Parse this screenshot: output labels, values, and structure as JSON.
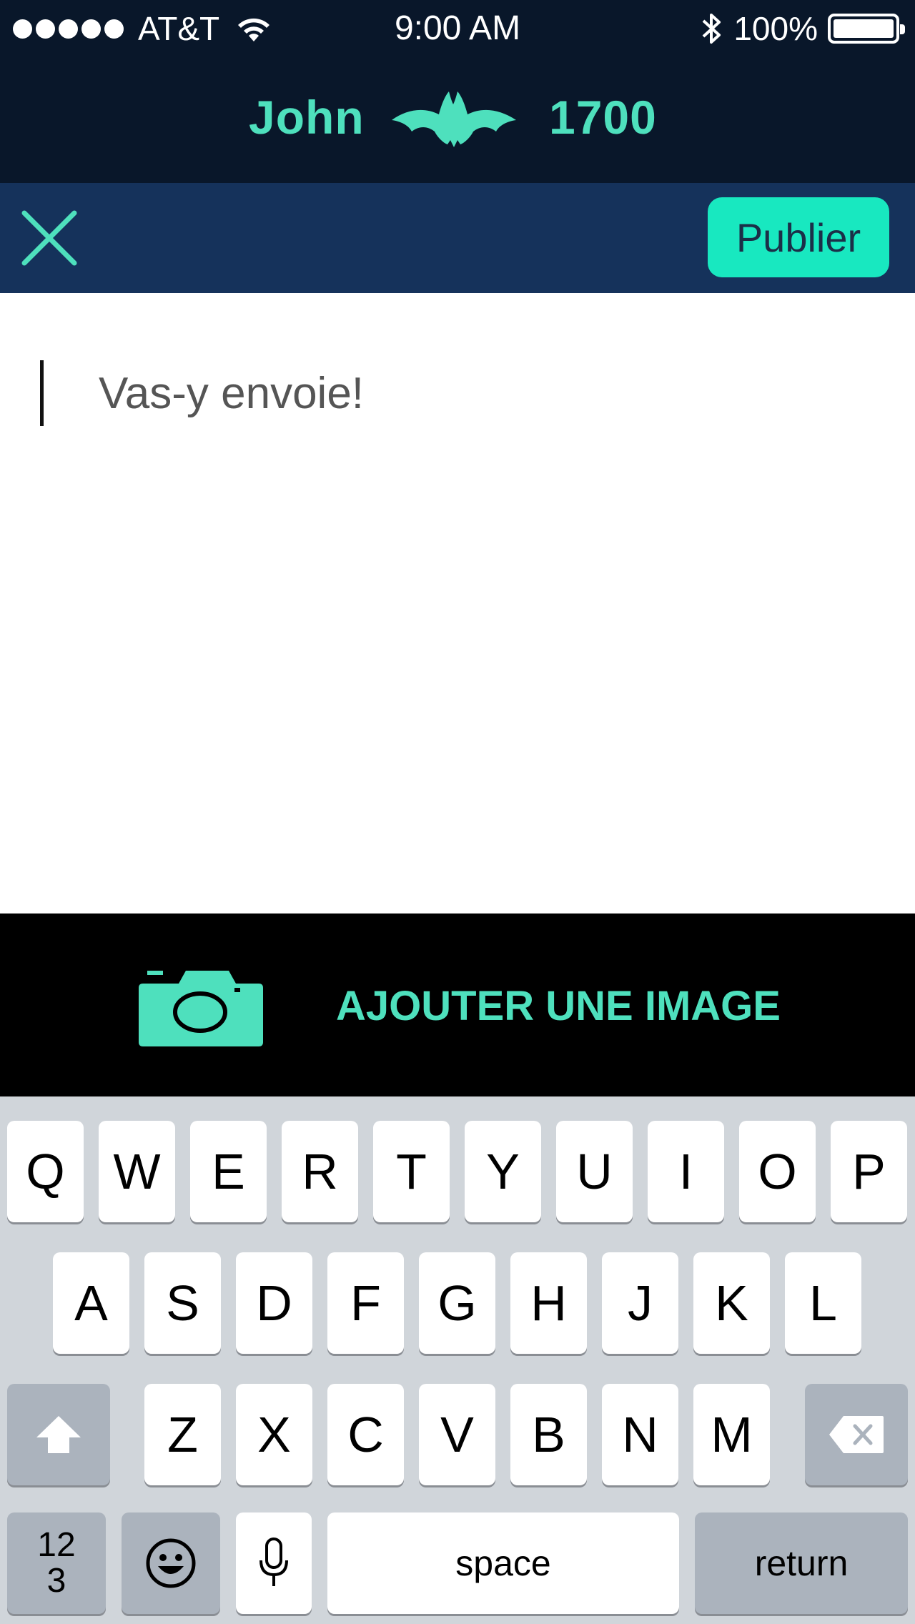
{
  "status_bar": {
    "carrier": "AT&T",
    "time": "9:00 AM",
    "battery_percent": "100%",
    "battery_level": 1.0
  },
  "header": {
    "user_name": "John",
    "score": "1700",
    "logo_icon": "bat-logo-icon"
  },
  "toolbar": {
    "close_icon": "close-icon",
    "publish_label": "Publier"
  },
  "compose": {
    "placeholder": "Vas-y envoie!",
    "value": ""
  },
  "add_image": {
    "icon": "camera-icon",
    "label": "AJOUTER UNE IMAGE"
  },
  "keyboard": {
    "row1": [
      "Q",
      "W",
      "E",
      "R",
      "T",
      "Y",
      "U",
      "I",
      "O",
      "P"
    ],
    "row2": [
      "A",
      "S",
      "D",
      "F",
      "G",
      "H",
      "J",
      "K",
      "L"
    ],
    "row3": [
      "Z",
      "X",
      "C",
      "V",
      "B",
      "N",
      "M"
    ],
    "numbers_label_line1": "12",
    "numbers_label_line2": "3",
    "space_label": "space",
    "return_label": "return"
  },
  "colors": {
    "header_bg": "#09172a",
    "toolbar_bg": "#15325b",
    "accent": "#4ee0bd",
    "publish_bg": "#18e8c0"
  }
}
